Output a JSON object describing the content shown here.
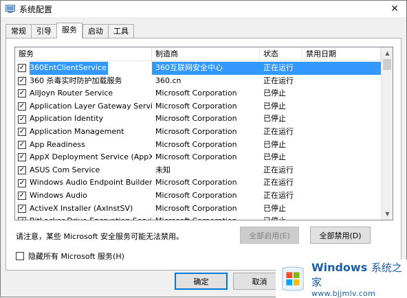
{
  "window": {
    "title": "系统配置"
  },
  "tabs": [
    {
      "label": "常规"
    },
    {
      "label": "引导"
    },
    {
      "label": "服务"
    },
    {
      "label": "启动"
    },
    {
      "label": "工具"
    }
  ],
  "table": {
    "headers": [
      "服务",
      "制造商",
      "状态",
      "禁用日期"
    ],
    "rows": [
      {
        "name": "360EntClientService",
        "vendor": "360互联网安全中心",
        "status": "正在运行",
        "date": ""
      },
      {
        "name": "360 杀毒实时防护加载服务",
        "vendor": "360.cn",
        "status": "正在运行",
        "date": ""
      },
      {
        "name": "AllJoyn Router Service",
        "vendor": "Microsoft Corporation",
        "status": "已停止",
        "date": ""
      },
      {
        "name": "Application Layer Gateway Service",
        "vendor": "Microsoft Corporation",
        "status": "已停止",
        "date": ""
      },
      {
        "name": "Application Identity",
        "vendor": "Microsoft Corporation",
        "status": "已停止",
        "date": ""
      },
      {
        "name": "Application Management",
        "vendor": "Microsoft Corporation",
        "status": "正在运行",
        "date": ""
      },
      {
        "name": "App Readiness",
        "vendor": "Microsoft Corporation",
        "status": "已停止",
        "date": ""
      },
      {
        "name": "AppX Deployment Service (AppX...",
        "vendor": "Microsoft Corporation",
        "status": "已停止",
        "date": ""
      },
      {
        "name": "ASUS Com Service",
        "vendor": "未知",
        "status": "正在运行",
        "date": ""
      },
      {
        "name": "Windows Audio Endpoint Builder",
        "vendor": "Microsoft Corporation",
        "status": "正在运行",
        "date": ""
      },
      {
        "name": "Windows Audio",
        "vendor": "Microsoft Corporation",
        "status": "正在运行",
        "date": ""
      },
      {
        "name": "ActiveX Installer (AxInstSV)",
        "vendor": "Microsoft Corporation",
        "status": "已停止",
        "date": ""
      },
      {
        "name": "BitLocker Drive Encryption Service",
        "vendor": "Microsoft Corporation",
        "status": "已停止",
        "date": ""
      }
    ]
  },
  "note": "请注意，某些 Microsoft 安全服务可能无法禁用。",
  "buttons": {
    "enable_all": "全部启用(E)",
    "disable_all": "全部禁用(D)",
    "ok": "确定",
    "cancel": "取消"
  },
  "hide_ms": {
    "label": "隐藏所有 Microsoft 服务(H)",
    "checked": false
  },
  "watermark": {
    "brand": "Windows",
    "brand_zh": "系统之家",
    "url": "www.bjjmlv.com"
  },
  "colors": {
    "selection": "#3399ff",
    "accent": "#0078d7",
    "watermark": "#1a5ea8"
  }
}
